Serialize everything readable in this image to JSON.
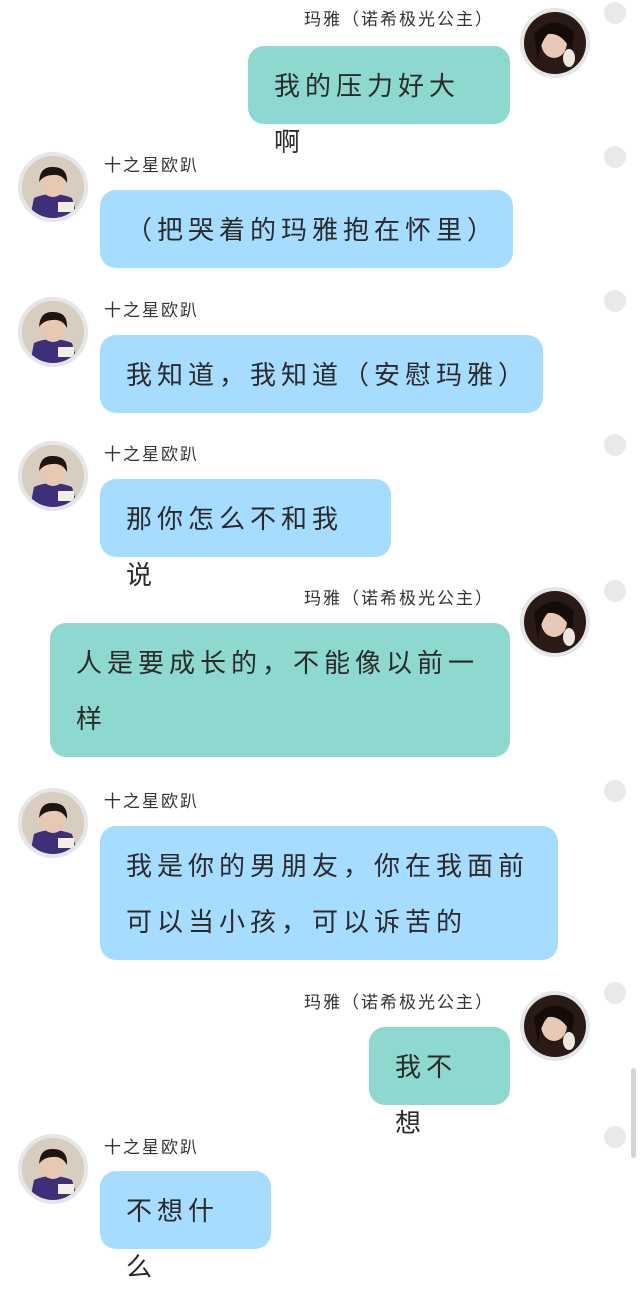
{
  "users": {
    "maya": "玛雅（诺希极光公主）",
    "boy": "十之星欧趴"
  },
  "messages": [
    {
      "sender": "maya",
      "side": "right",
      "text": "我的压力好大啊"
    },
    {
      "sender": "boy",
      "side": "left",
      "text": "（把哭着的玛雅抱在怀里）"
    },
    {
      "sender": "boy",
      "side": "left",
      "text": "我知道，我知道（安慰玛雅）"
    },
    {
      "sender": "boy",
      "side": "left",
      "text": "那你怎么不和我说"
    },
    {
      "sender": "maya",
      "side": "right",
      "text": "人是要成长的，不能像以前一样"
    },
    {
      "sender": "boy",
      "side": "left",
      "text": "我是你的男朋友，你在我面前可以当小孩，可以诉苦的"
    },
    {
      "sender": "maya",
      "side": "right",
      "text": "我不想"
    },
    {
      "sender": "boy",
      "side": "left",
      "text": "不想什么"
    }
  ],
  "colors": {
    "right_bubble": "#8dd8cf",
    "left_bubble": "#a5dcff"
  }
}
